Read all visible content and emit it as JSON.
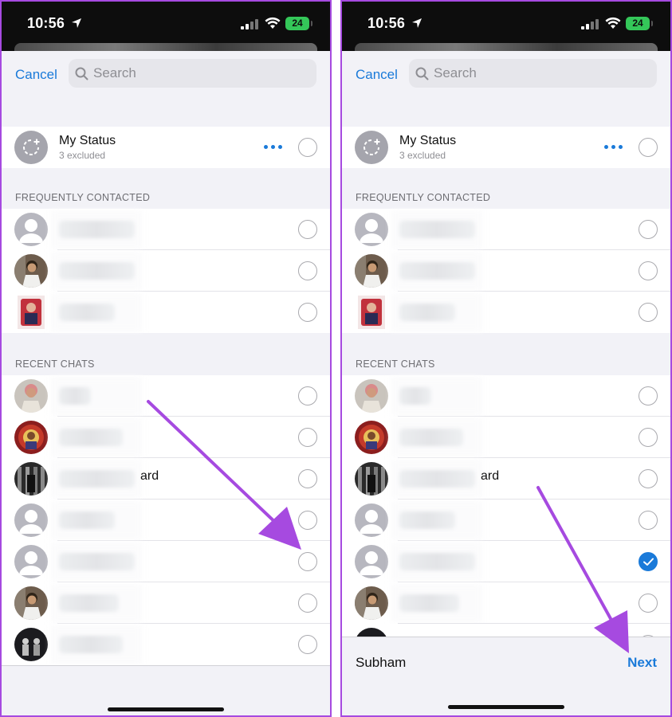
{
  "status_bar": {
    "time": "10:56",
    "battery": "24"
  },
  "sheet": {
    "cancel_label": "Cancel",
    "search_placeholder": "Search"
  },
  "my_status": {
    "name": "My Status",
    "subtitle": "3 excluded"
  },
  "sections": {
    "frequent": "FREQUENTLY CONTACTED",
    "recent": "RECENT CHATS"
  },
  "frequent_rows": [
    {
      "avatar": "person-placeholder-icon"
    },
    {
      "avatar": "contact-photo-man"
    },
    {
      "avatar": "contact-photo-figure"
    }
  ],
  "recent_rows": [
    {
      "avatar": "contact-photo-pink",
      "visible_text": ""
    },
    {
      "avatar": "contact-photo-red",
      "visible_text": ""
    },
    {
      "avatar": "contact-photo-dark",
      "visible_text": "ard"
    },
    {
      "avatar": "person-placeholder-icon",
      "visible_text": ""
    },
    {
      "avatar": "person-placeholder-icon",
      "visible_text": ""
    },
    {
      "avatar": "contact-photo-man",
      "visible_text": ""
    },
    {
      "avatar": "contact-photo-night",
      "visible_text": ""
    }
  ],
  "left_panel": {
    "selected_index": null
  },
  "right_panel": {
    "selected_index": 4,
    "footer_name": "Subham",
    "next_label": "Next"
  },
  "colors": {
    "accent": "#1a7ad9",
    "annotation_arrow": "#a64ae0",
    "sheet_background": "#f2f2f7"
  }
}
